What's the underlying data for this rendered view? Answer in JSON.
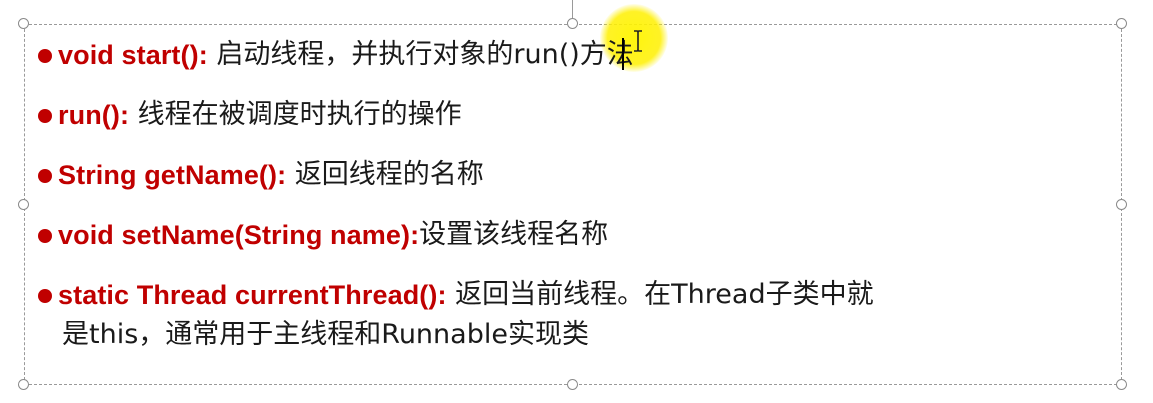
{
  "slide": {
    "items": [
      {
        "signature": "void start():",
        "description": "启动线程，并执行对象的run()方法"
      },
      {
        "signature": "run():",
        "description": "线程在被调度时执行的操作"
      },
      {
        "signature": "String getName():",
        "description": "返回线程的名称"
      },
      {
        "signature": "void setName(String name):",
        "description": "设置该线程名称"
      },
      {
        "signature": "static Thread currentThread():",
        "description": "返回当前线程。在Thread子类中就",
        "continuation": "是this，通常用于主线程和Runnable实现类"
      }
    ]
  },
  "colors": {
    "signature": "#c00000",
    "bullet": "#c00000",
    "text": "#1a1a1a",
    "cursor_highlight": "#fff200",
    "frame": "#9a9a9a"
  },
  "icons": {
    "cursor": "ibeam-cursor-icon",
    "bullet": "bullet-dot-icon",
    "handle": "resize-handle-icon"
  }
}
